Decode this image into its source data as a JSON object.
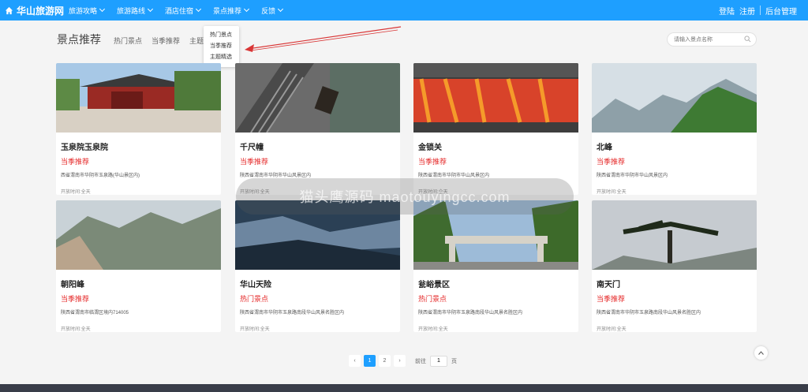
{
  "brand": {
    "name": "华山旅游网"
  },
  "nav": [
    {
      "label": "旅游攻略"
    },
    {
      "label": "旅游路线"
    },
    {
      "label": "酒店住宿"
    },
    {
      "label": "景点推荐"
    },
    {
      "label": "反馈"
    }
  ],
  "auth": {
    "login": "登陆",
    "register": "注册",
    "admin": "后台管理"
  },
  "dropdown": [
    "热门景点",
    "当季推荐",
    "主题精选"
  ],
  "subhead": {
    "title": "景点推荐",
    "tabs": [
      "热门景点",
      "当季推荐",
      "主题精选"
    ]
  },
  "search": {
    "placeholder": "请输入景点名称"
  },
  "cards": [
    {
      "name": "玉泉院玉泉院",
      "tag": "当季推荐",
      "addr": "西省渭南市华阴市玉泉路(华山景区内)",
      "hours": "开放时间:全天"
    },
    {
      "name": "千尺幢",
      "tag": "当季推荐",
      "addr": "陕西省渭南市华阴市华山风景区内",
      "hours": "开放时间:全天"
    },
    {
      "name": "金锁关",
      "tag": "当季推荐",
      "addr": "陕西省渭南市华阴市华山风景区内",
      "hours": "开放时间:全天"
    },
    {
      "name": "北峰",
      "tag": "当季推荐",
      "addr": "陕西省渭南市华阴市华山风景区内",
      "hours": "开放时间:全天"
    },
    {
      "name": "朝阳峰",
      "tag": "当季推荐",
      "addr": "陕西省渭南市临渭区境内714005",
      "hours": "开放时间:全天"
    },
    {
      "name": "华山天险",
      "tag": "热门景点",
      "addr": "陕西省渭南市华阴市玉泉路南段华山风景名胜区内",
      "hours": "开放时间:全天"
    },
    {
      "name": "瓮峪景区",
      "tag": "热门景点",
      "addr": "陕西省渭南市华阴市玉泉路南段华山风景名胜区内",
      "hours": "开放时间:全天"
    },
    {
      "name": "南天门",
      "tag": "当季推荐",
      "addr": "陕西省渭南市华阴市玉泉路南段华山风景名胜区内",
      "hours": "开放时间:全天"
    }
  ],
  "pager": {
    "prev": "‹",
    "pages": [
      "1",
      "2"
    ],
    "next": "›",
    "goto": "前往",
    "current": "1",
    "page_word": "页"
  },
  "watermark": {
    "text": "猫头鹰源码 maotouyingcc.com"
  },
  "colors": {
    "primary": "#1e9fff",
    "tag_red": "#e52929",
    "footer": "#393d49"
  }
}
